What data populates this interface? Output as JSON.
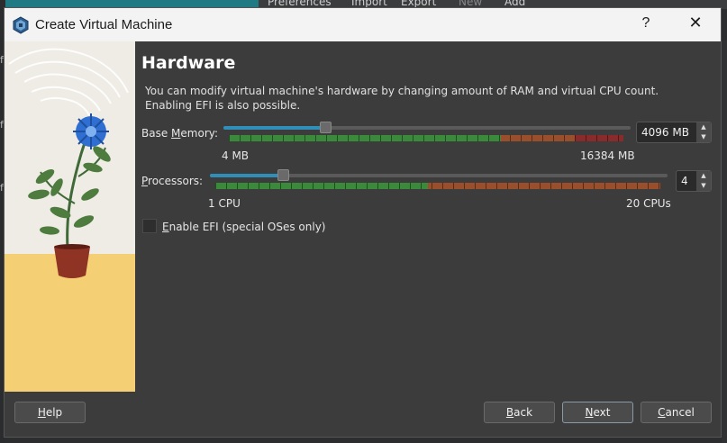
{
  "host": {
    "menu": [
      "Preferences",
      "Import",
      "Export",
      "New",
      "Add"
    ],
    "left_letters": [
      "f",
      "f",
      "f"
    ]
  },
  "dialog": {
    "title": "Create Virtual Machine",
    "help_glyph": "?",
    "close_glyph": "✕",
    "heading": "Hardware",
    "description_line1": "You can modify virtual machine's hardware by changing amount of RAM and virtual CPU count.",
    "description_line2": "Enabling EFI is also possible."
  },
  "memory": {
    "label_pre": "Base ",
    "label_mnemonic": "M",
    "label_post": "emory:",
    "value": "4096 MB",
    "min_label": "4 MB",
    "max_label": "16384 MB",
    "fraction": 0.25
  },
  "processors": {
    "label_pre": "",
    "label_mnemonic": "P",
    "label_post": "rocessors:",
    "value": "4",
    "min_label": "1 CPU",
    "max_label": "20 CPUs",
    "fraction": 0.16
  },
  "efi": {
    "label_mnemonic": "E",
    "label_post": "nable EFI (special OSes only)",
    "checked": false
  },
  "buttons": {
    "help": {
      "mnemonic": "H",
      "rest": "elp"
    },
    "back": {
      "mnemonic": "B",
      "rest": "ack"
    },
    "next": {
      "mnemonic": "N",
      "rest": "ext"
    },
    "cancel": {
      "mnemonic": "C",
      "rest": "ancel"
    }
  },
  "colors": {
    "green": "#3b8a3c",
    "orange": "#9a4f2c",
    "red": "#8a2b2b",
    "accent": "#2f8fb8"
  }
}
